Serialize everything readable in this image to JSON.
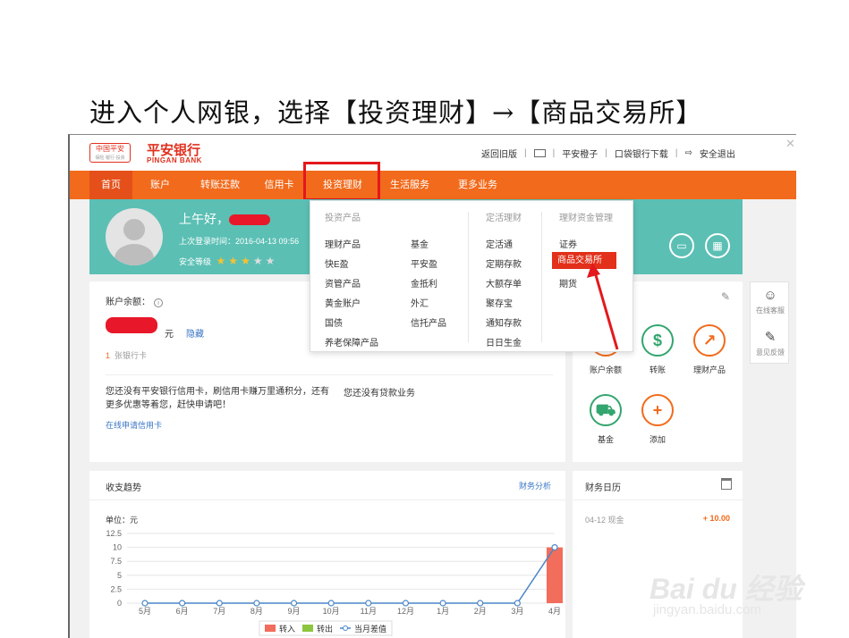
{
  "caption": "进入个人网银，选择【投资理财】→【商品交易所】",
  "header": {
    "logo_small_line1": "中国平安",
    "logo_small_line2": "保险·银行·投资",
    "logo_name": "平安银行",
    "logo_en": "PINGAN BANK",
    "links": [
      "返回旧版",
      "平安橙子",
      "口袋银行下载",
      "安全退出"
    ],
    "close": "✕"
  },
  "nav": {
    "items": [
      "首页",
      "账户",
      "转账还款",
      "信用卡",
      "投资理财",
      "生活服务",
      "更多业务"
    ],
    "search_placeholder": ""
  },
  "profile": {
    "greeting": "上午好，",
    "last_login_label": "上次登录时间：",
    "last_login_value": "2016-04-13 09:56",
    "security_label": "安全等级",
    "stars_filled": 3,
    "stars_total": 5
  },
  "dropdown": {
    "headers": [
      "投资产品",
      "定活理财",
      "理财资金管理"
    ],
    "col1": [
      "理财产品",
      "快E盈",
      "资管产品",
      "黄金账户",
      "国债",
      "养老保障产品"
    ],
    "col2": [
      "基金",
      "平安盈",
      "金抵利",
      "外汇",
      "信托产品"
    ],
    "col3": [
      "定活通",
      "定期存款",
      "大额存单",
      "聚存宝",
      "通知存款",
      "日日生金"
    ],
    "col4": [
      "证券",
      "商品交易所",
      "期货"
    ],
    "active": "商品交易所"
  },
  "account": {
    "balance_label": "账户余额：",
    "unit": "元",
    "hide": "隐藏",
    "card_count": "1",
    "card_count_label": "张银行卡",
    "credit_tip": "您还没有平安银行信用卡，刷信用卡赚万里通积分，还有更多优惠等着您，赶快申请吧！",
    "credit_link": "在线申请信用卡",
    "loan_tip": "您还没有贷款业务"
  },
  "quick": {
    "items": [
      "账户余额",
      "转账",
      "理财产品",
      "基金",
      "添加"
    ]
  },
  "side": {
    "items": [
      "在线客服",
      "意见反馈"
    ]
  },
  "trend": {
    "title": "收支趋势",
    "link": "财务分析"
  },
  "calendar": {
    "title": "财务日历",
    "entry": "04-12 现金",
    "amount": "+ 10.00"
  },
  "watermark": "Bai du 经验",
  "watermark2": "jingyan.baidu.com",
  "chart_data": {
    "type": "bar",
    "title": "",
    "unit_label": "单位：元",
    "categories": [
      "5月",
      "6月",
      "7月",
      "8月",
      "9月",
      "10月",
      "11月",
      "12月",
      "1月",
      "2月",
      "3月",
      "4月"
    ],
    "series": [
      {
        "name": "转入",
        "type": "bar",
        "values": [
          0,
          0,
          0,
          0,
          0,
          0,
          0,
          0,
          0,
          0,
          0,
          10
        ]
      },
      {
        "name": "转出",
        "type": "bar",
        "values": [
          0,
          0,
          0,
          0,
          0,
          0,
          0,
          0,
          0,
          0,
          0,
          0
        ]
      },
      {
        "name": "当月差值",
        "type": "line",
        "values": [
          0,
          0,
          0,
          0,
          0,
          0,
          0,
          0,
          0,
          0,
          0,
          10
        ]
      }
    ],
    "yticks": [
      "12.5",
      "10",
      "7.5",
      "5",
      "2.5",
      "0"
    ],
    "ylim": [
      0,
      12.5
    ],
    "grid": true,
    "legend": "bottom",
    "colors": {
      "in": "#f26d5b",
      "out": "#8cc63f",
      "diff": "#4a86c8"
    }
  }
}
